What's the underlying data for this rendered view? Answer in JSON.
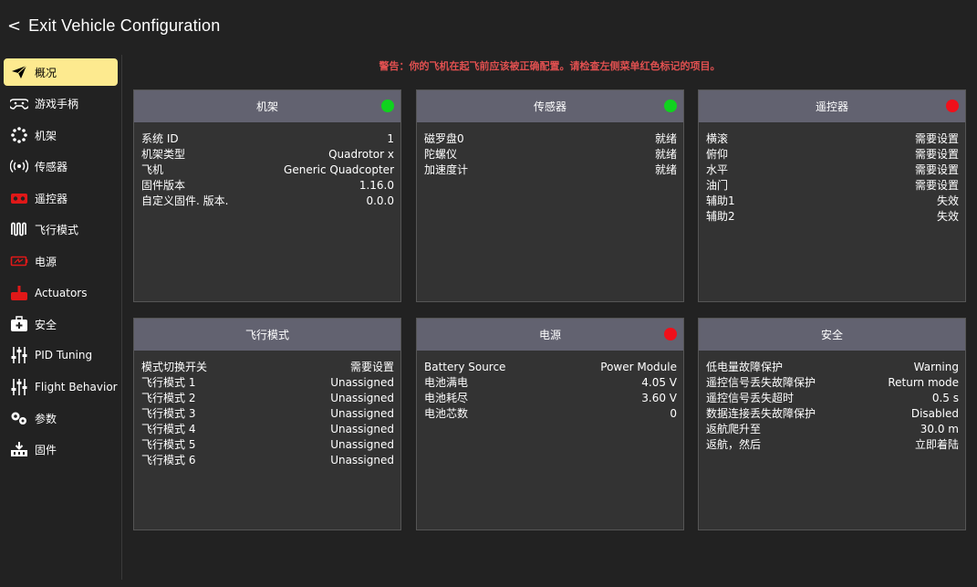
{
  "header": {
    "back_chevron": "<",
    "title": "Exit Vehicle Configuration"
  },
  "sidebar": {
    "items": [
      {
        "label": "概况",
        "icon": "paper-plane-icon",
        "active": true
      },
      {
        "label": "游戏手柄",
        "icon": "gamepad-icon"
      },
      {
        "label": "机架",
        "icon": "airframe-icon"
      },
      {
        "label": "传感器",
        "icon": "sensors-icon"
      },
      {
        "label": "遥控器",
        "icon": "radio-controller-icon"
      },
      {
        "label": "飞行模式",
        "icon": "flight-modes-icon"
      },
      {
        "label": "电源",
        "icon": "battery-icon"
      },
      {
        "label": "Actuators",
        "icon": "actuators-icon"
      },
      {
        "label": "安全",
        "icon": "safety-icon"
      },
      {
        "label": "PID Tuning",
        "icon": "sliders-icon"
      },
      {
        "label": "Flight Behavior",
        "icon": "sliders-icon"
      },
      {
        "label": "参数",
        "icon": "gears-icon"
      },
      {
        "label": "固件",
        "icon": "firmware-icon"
      }
    ]
  },
  "warning": "警告：你的飞机在起飞前应该被正确配置。请检查左侧菜单红色标记的项目。",
  "colors": {
    "accent": "#fdea8f",
    "status_ok": "#10d21e",
    "status_error": "#f0101a",
    "warning_text": "#e05050"
  },
  "panels": [
    {
      "title": "机架",
      "status": "green",
      "rows": [
        {
          "label": "系统 ID",
          "value": "1"
        },
        {
          "label": "机架类型",
          "value": "Quadrotor x"
        },
        {
          "label": "飞机",
          "value": "Generic Quadcopter"
        },
        {
          "label": "固件版本",
          "value": "1.16.0"
        },
        {
          "label": "自定义固件. 版本.",
          "value": "0.0.0"
        }
      ]
    },
    {
      "title": "传感器",
      "status": "green",
      "rows": [
        {
          "label": "磁罗盘0",
          "value": "就绪"
        },
        {
          "label": "陀螺仪",
          "value": "就绪"
        },
        {
          "label": "加速度计",
          "value": "就绪"
        }
      ]
    },
    {
      "title": "遥控器",
      "status": "red",
      "rows": [
        {
          "label": "横滚",
          "value": "需要设置"
        },
        {
          "label": "俯仰",
          "value": "需要设置"
        },
        {
          "label": "水平",
          "value": "需要设置"
        },
        {
          "label": "油门",
          "value": "需要设置"
        },
        {
          "label": "辅助1",
          "value": "失效"
        },
        {
          "label": "辅助2",
          "value": "失效"
        }
      ]
    },
    {
      "title": "飞行模式",
      "status": "",
      "rows": [
        {
          "label": "模式切换开关",
          "value": "需要设置"
        },
        {
          "label": "飞行模式 1",
          "value": "Unassigned"
        },
        {
          "label": "飞行模式 2",
          "value": "Unassigned"
        },
        {
          "label": "飞行模式 3",
          "value": "Unassigned"
        },
        {
          "label": "飞行模式 4",
          "value": "Unassigned"
        },
        {
          "label": "飞行模式 5",
          "value": "Unassigned"
        },
        {
          "label": "飞行模式 6",
          "value": "Unassigned"
        }
      ]
    },
    {
      "title": "电源",
      "status": "red",
      "rows": [
        {
          "label": "Battery Source",
          "value": "Power Module"
        },
        {
          "label": "电池满电",
          "value": "4.05 V"
        },
        {
          "label": "电池耗尽",
          "value": "3.60 V"
        },
        {
          "label": "电池芯数",
          "value": "0"
        }
      ]
    },
    {
      "title": "安全",
      "status": "",
      "rows": [
        {
          "label": "低电量故障保护",
          "value": "Warning"
        },
        {
          "label": "遥控信号丢失故障保护",
          "value": "Return mode"
        },
        {
          "label": "遥控信号丢失超时",
          "value": "0.5 s"
        },
        {
          "label": "数据连接丢失故障保护",
          "value": "Disabled"
        },
        {
          "label": "返航爬升至",
          "value": "30.0 m"
        },
        {
          "label": "返航，然后",
          "value": "立即着陆"
        }
      ]
    }
  ]
}
